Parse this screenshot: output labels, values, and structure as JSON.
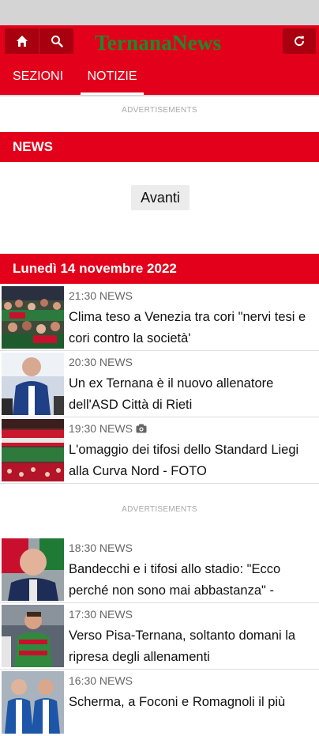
{
  "header": {
    "brand": "TernanaNews",
    "icons": [
      "home-icon",
      "search-icon",
      "refresh-icon"
    ],
    "tabs": [
      {
        "label": "SEZIONI",
        "active": false
      },
      {
        "label": "NOTIZIE",
        "active": true
      }
    ],
    "colors": {
      "bar": "#e2001a",
      "button": "#a8000f",
      "brand": "#1c8a2c"
    }
  },
  "ads": {
    "label": "ADVERTISEMENTS"
  },
  "news_section": {
    "title": "NEWS",
    "next_button": "Avanti"
  },
  "date_section": {
    "title": "Lunedì 14 novembre 2022"
  },
  "articles": [
    {
      "time": "21:30 NEWS",
      "title": "Clima teso a Venezia tra cori \"nervi tesi e cori contro la società'",
      "thumb": "fans-crowd-photo"
    },
    {
      "time": "20:30 NEWS",
      "title": "Un ex Ternana è il nuovo allenatore dell'ASD Città di Rieti",
      "thumb": "coach-photo"
    },
    {
      "time": "19:30 NEWS",
      "title": "L'omaggio dei tifosi dello Standard Liegi alla Curva Nord - FOTO",
      "thumb": "curva-banner-photo",
      "icon": "camera-icon"
    },
    {
      "time": "18:30 NEWS",
      "title": "Bandecchi e i tifosi allo stadio: \"Ecco perché non sono mai abbastanza\" -",
      "thumb": "president-photo"
    },
    {
      "time": "17:30 NEWS",
      "title": "Verso Pisa-Ternana, soltanto domani la ripresa degli allenamenti",
      "thumb": "player-photo"
    },
    {
      "time": "16:30 NEWS",
      "title": "Scherma, a Foconi e Romagnoli il più",
      "thumb": "fencers-photo"
    }
  ]
}
